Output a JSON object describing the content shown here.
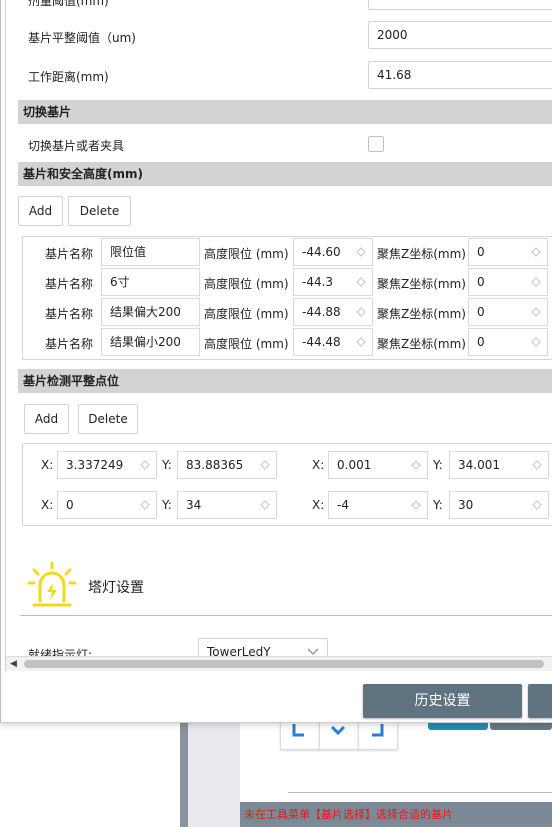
{
  "form": {
    "top_label_partial": "剂量阈值(mm)",
    "flatness": {
      "label": "基片平整阈值（um)",
      "value": "2000"
    },
    "work_distance": {
      "label": "工作距离(mm)",
      "value": "41.68"
    }
  },
  "switch_section": {
    "title": "切换基片",
    "checkbox_label": "切换基片或者夹具",
    "checked": false
  },
  "height_section": {
    "title": "基片和安全高度(mm)",
    "add_label": "Add",
    "delete_label": "Delete",
    "name_label": "基片名称",
    "limit_label": "高度限位 (mm)",
    "focus_label": "聚焦Z坐标(mm)",
    "rows": [
      {
        "name": "限位值",
        "limit": "-44.60",
        "focus": "0"
      },
      {
        "name": "6寸",
        "limit": "-44.3",
        "focus": "0"
      },
      {
        "name": "结果偏大200",
        "limit": "-44.88",
        "focus": "0"
      },
      {
        "name": "结果偏小200",
        "limit": "-44.48",
        "focus": "0"
      }
    ]
  },
  "points_section": {
    "title": "基片检测平整点位",
    "add_label": "Add",
    "delete_label": "Delete",
    "x_label": "X:",
    "y_label": "Y:",
    "rows": [
      {
        "x1": "3.337249",
        "y1": "83.88365",
        "x2": "0.001",
        "y2": "34.001"
      },
      {
        "x1": "0",
        "y1": "34",
        "x2": "-4",
        "y2": "30"
      }
    ]
  },
  "tower_light": {
    "title": "塔灯设置",
    "ready_label": "就绪指示灯:",
    "ready_value": "TowerLedY",
    "icon": "warning-light-icon",
    "icon_color": "#f2d81c"
  },
  "footer": {
    "history_button": "历史设置"
  },
  "background": {
    "status_text": "未在工具菜单【基片选择】选择合适的基片",
    "status_color": "#e01919",
    "accent": "#1f8fb0"
  }
}
